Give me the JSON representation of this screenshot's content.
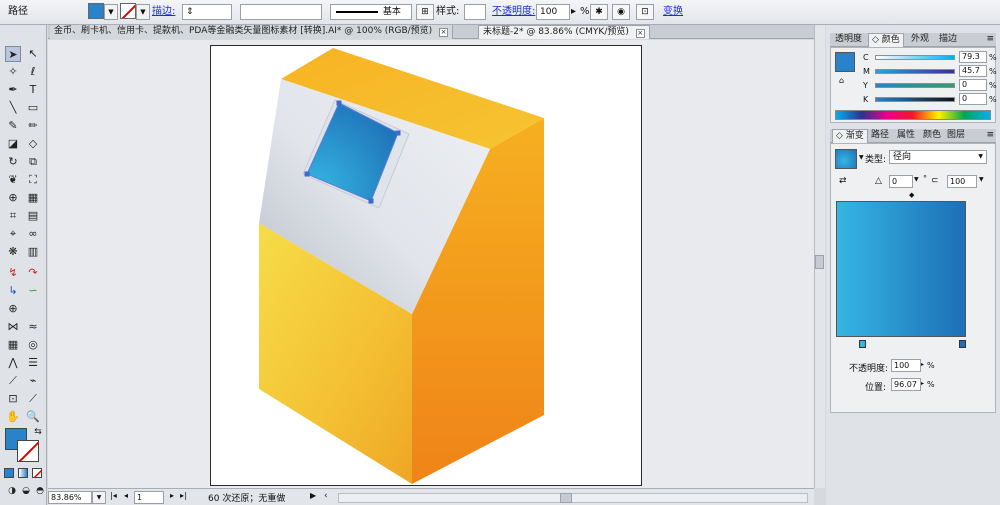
{
  "control_bar": {
    "object_type": "路径",
    "stroke_label": "描边:",
    "stroke_profile": "基本",
    "style_label": "样式:",
    "opacity_label": "不透明度:",
    "opacity_value": "100",
    "opacity_unit": "%",
    "transform_link": "变换"
  },
  "tabs": [
    {
      "label": "金币、刷卡机、信用卡、提款机、PDA等金融类矢量图标素材 [转换].AI* @ 100% (RGB/预览)",
      "active": false
    },
    {
      "label": "未标题-2* @ 83.86% (CMYK/预览)",
      "active": true
    }
  ],
  "status_bar": {
    "zoom": "83.86%",
    "artboard_number": "1",
    "history": "60 次还原；无重做"
  },
  "color_panel": {
    "tabs": [
      "透明度",
      "颜色",
      "外观",
      "描边"
    ],
    "active_tab": "颜色",
    "channels": [
      {
        "letter": "C",
        "value": "79.3"
      },
      {
        "letter": "M",
        "value": "45.7"
      },
      {
        "letter": "Y",
        "value": "0"
      },
      {
        "letter": "K",
        "value": "0"
      }
    ],
    "swatch_color": "#2a82c8"
  },
  "gradient_panel": {
    "tabs": [
      "渐变",
      "路径",
      "属性",
      "颜色",
      "图层"
    ],
    "active_tab": "渐变",
    "type_label": "类型:",
    "type_value": "径向",
    "angle_value": "0",
    "aspect_value": "100",
    "opacity_label": "不透明度:",
    "opacity_value": "100",
    "location_label": "位置:",
    "location_value": "96.07",
    "percent": "%",
    "degree": "°",
    "stop_start": "#35b6e2",
    "stop_end": "#1e6fb7"
  }
}
